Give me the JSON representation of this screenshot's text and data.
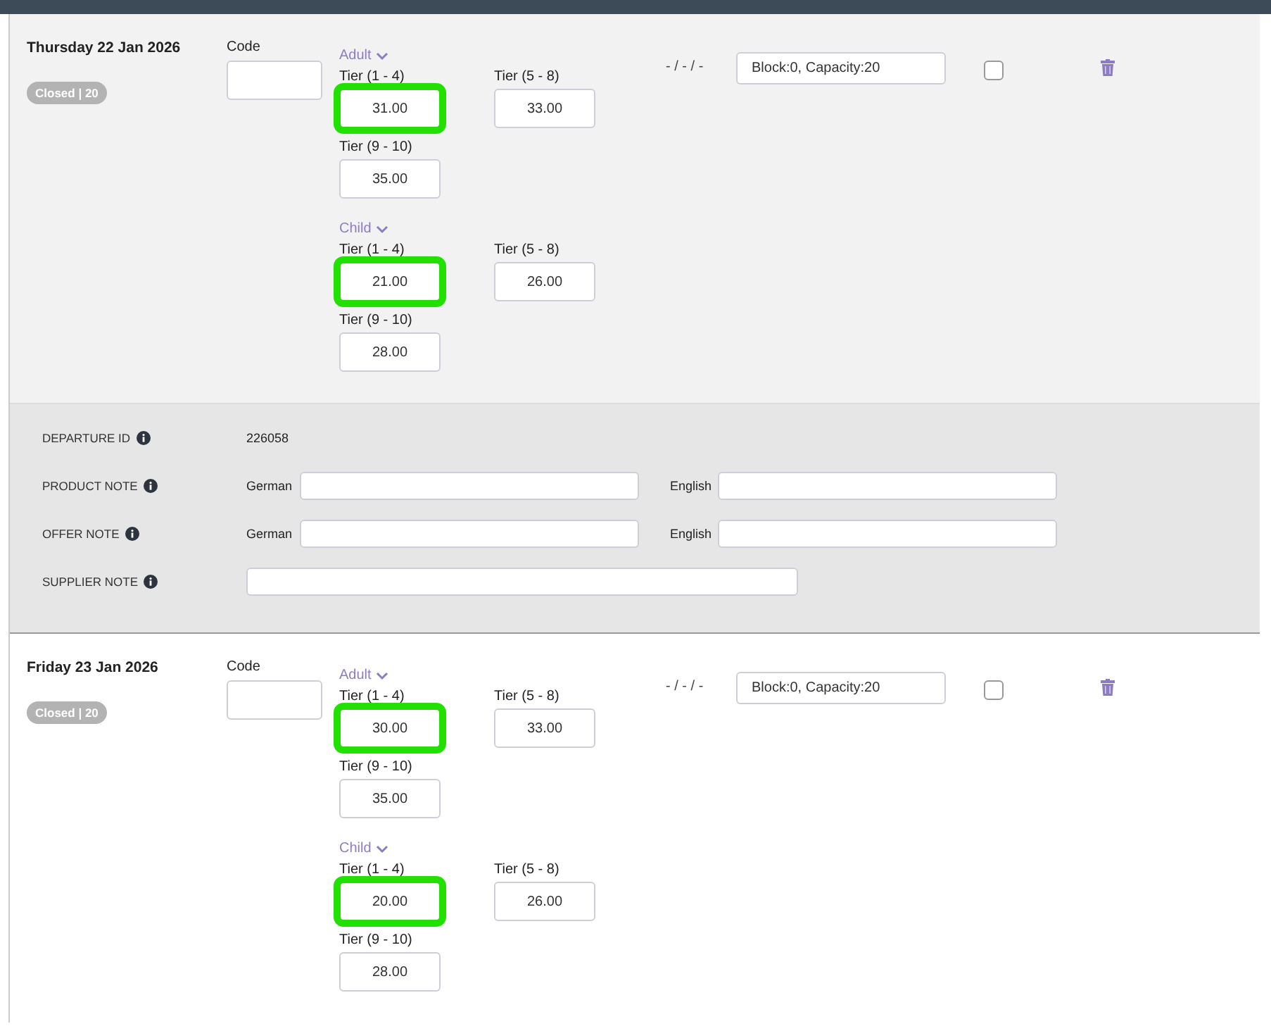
{
  "departures": [
    {
      "date": "Thursday 22 Jan 2026",
      "status": "Closed | 20",
      "code_label": "Code",
      "groups": [
        {
          "name": "Adult",
          "expanded": true,
          "tiers": [
            {
              "label": "Tier (1 - 4)",
              "value": "31.00",
              "highlighted": true
            },
            {
              "label": "Tier (5 - 8)",
              "value": "33.00",
              "highlighted": false
            },
            {
              "label": "Tier (9 - 10)",
              "value": "35.00",
              "highlighted": false
            }
          ]
        },
        {
          "name": "Child",
          "expanded": true,
          "tiers": [
            {
              "label": "Tier (1 - 4)",
              "value": "21.00",
              "highlighted": true
            },
            {
              "label": "Tier (5 - 8)",
              "value": "26.00",
              "highlighted": false
            },
            {
              "label": "Tier (9 - 10)",
              "value": "28.00",
              "highlighted": false
            }
          ]
        }
      ],
      "dates": "- / - / -",
      "block": "Block:0, Capacity:20",
      "checked": false,
      "details": [
        {
          "kind": "value",
          "label": "DEPARTURE ID",
          "value": "226058"
        },
        {
          "kind": "bilingual",
          "label": "PRODUCT NOTE",
          "fields": [
            {
              "label": "German"
            },
            {
              "label": "English"
            }
          ]
        },
        {
          "kind": "bilingual",
          "label": "OFFER NOTE",
          "fields": [
            {
              "label": "German"
            },
            {
              "label": "English"
            }
          ]
        },
        {
          "kind": "single",
          "label": "SUPPLIER NOTE"
        }
      ]
    },
    {
      "date": "Friday 23 Jan 2026",
      "status": "Closed | 20",
      "code_label": "Code",
      "groups": [
        {
          "name": "Adult",
          "expanded": true,
          "tiers": [
            {
              "label": "Tier (1 - 4)",
              "value": "30.00",
              "highlighted": true
            },
            {
              "label": "Tier (5 - 8)",
              "value": "33.00",
              "highlighted": false
            },
            {
              "label": "Tier (9 - 10)",
              "value": "35.00",
              "highlighted": false
            }
          ]
        },
        {
          "name": "Child",
          "expanded": true,
          "tiers": [
            {
              "label": "Tier (1 - 4)",
              "value": "20.00",
              "highlighted": true
            },
            {
              "label": "Tier (5 - 8)",
              "value": "26.00",
              "highlighted": false
            },
            {
              "label": "Tier (9 - 10)",
              "value": "28.00",
              "highlighted": false
            }
          ]
        }
      ],
      "dates": "- / - / -",
      "block": "Block:0, Capacity:20",
      "checked": false
    }
  ]
}
